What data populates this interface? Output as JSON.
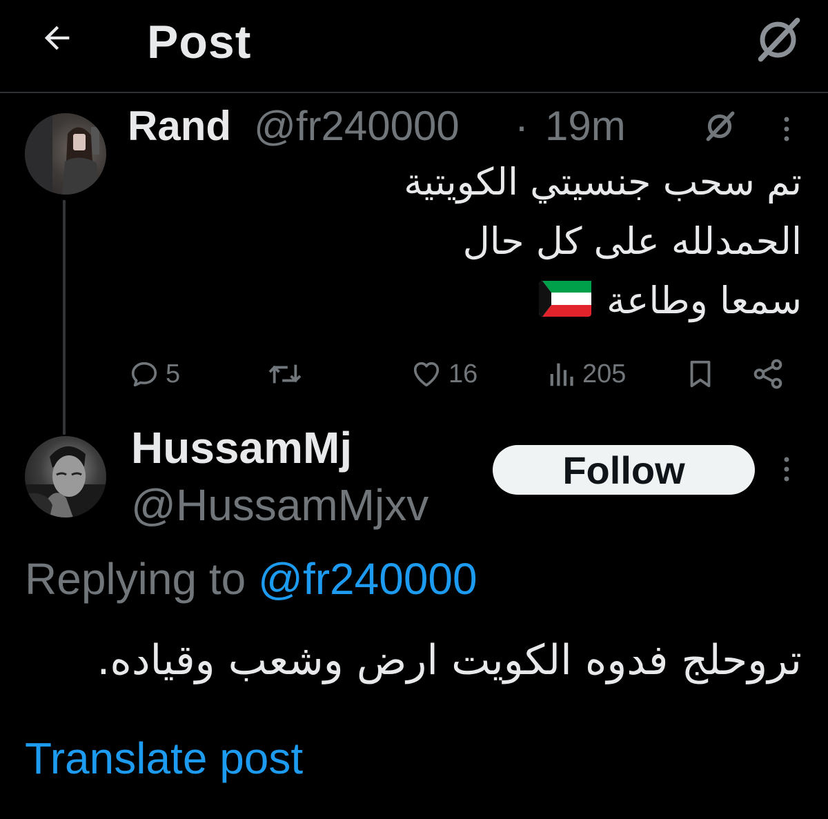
{
  "header": {
    "title": "Post",
    "back_icon": "arrow-left-icon",
    "grok_icon": "grok-icon"
  },
  "original_post": {
    "author_name": "Rand",
    "author_handle": "@fr240000",
    "separator": "·",
    "time": "19m",
    "lines": [
      "تم سحب جنسيتي الكويتية",
      "الحمدلله على كل حال",
      "سمعا وطاعة"
    ],
    "flag_emoji": "kuwait-flag",
    "stats": {
      "replies": "5",
      "likes": "16",
      "views": "205"
    }
  },
  "reply_post": {
    "author_name": "HussamMj",
    "author_handle": "@HussamMjxv",
    "follow_label": "Follow",
    "replying_prefix": "Replying to ",
    "replying_to": "@fr240000",
    "text": "تروحلج فدوه الكويت ارض وشعب وقياده.",
    "translate_label": "Translate post"
  },
  "colors": {
    "background": "#000000",
    "text_primary": "#e7e9ea",
    "text_secondary": "#71767b",
    "accent_blue": "#1d9bf0",
    "divider": "#2f3336"
  }
}
